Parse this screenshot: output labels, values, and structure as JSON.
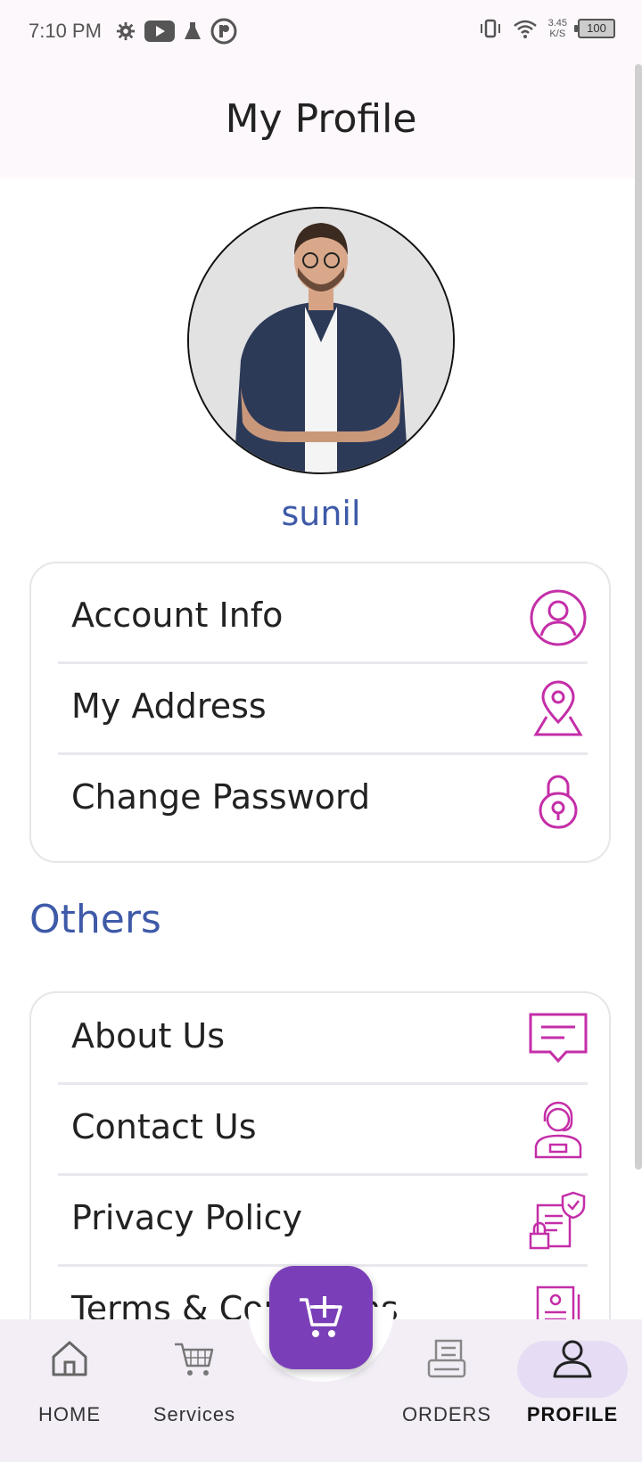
{
  "status": {
    "time": "7:10 PM",
    "net_speed_value": "3.45",
    "net_speed_unit": "K/S",
    "battery": "100"
  },
  "header": {
    "title": "My Profile"
  },
  "profile": {
    "name": "sunil"
  },
  "account_menu": [
    {
      "label": "Account Info",
      "icon": "user-circle-icon"
    },
    {
      "label": "My Address",
      "icon": "location-pin-icon"
    },
    {
      "label": "Change Password",
      "icon": "padlock-icon"
    }
  ],
  "others": {
    "title": "Others",
    "items": [
      {
        "label": "About Us",
        "icon": "chat-bubble-icon"
      },
      {
        "label": "Contact Us",
        "icon": "support-agent-icon"
      },
      {
        "label": "Privacy Policy",
        "icon": "policy-document-icon"
      },
      {
        "label": "Terms & Conditions",
        "icon": "terms-document-icon"
      }
    ]
  },
  "bottom_nav": {
    "home": "HOME",
    "services": "Services",
    "orders": "ORDERS",
    "profile": "PROFILE",
    "active": "PROFILE"
  },
  "colors": {
    "accent_blue": "#3e5aa8",
    "icon_magenta": "#c42ea8",
    "fab_purple": "#7a3fb8",
    "nav_background": "#f3eef6",
    "active_pill": "#e6ddf5"
  }
}
